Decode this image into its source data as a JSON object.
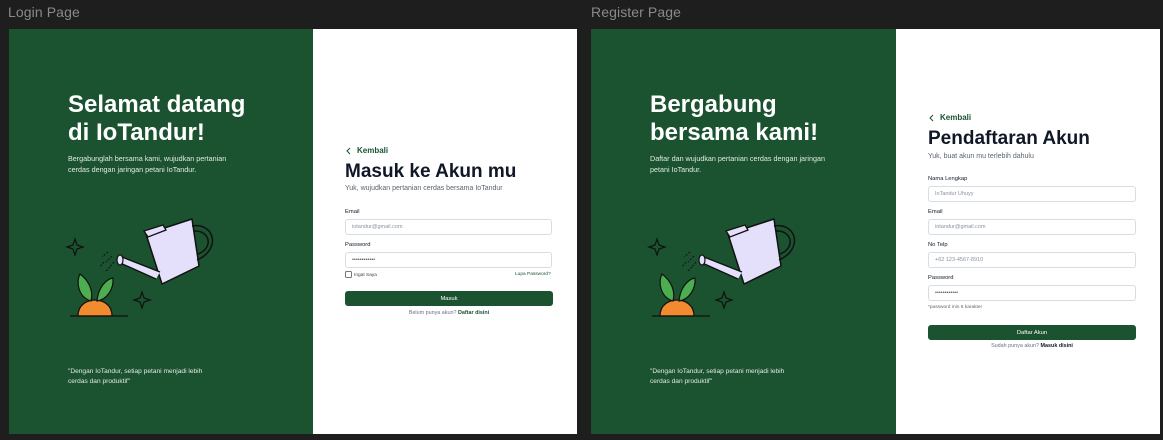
{
  "canvas": {
    "login_label": "Login Page",
    "register_label": "Register Page"
  },
  "login": {
    "hero_title_line1": "Selamat datang",
    "hero_title_line2": "di IoTandur!",
    "hero_subtitle": "Bergabunglah bersama kami, wujudkan pertanian cerdas dengan jaringan petani IoTandur.",
    "quote": "\"Dengan IoTandur, setiap petani menjadi lebih cerdas dan produktif\"",
    "back_label": "Kembali",
    "form_title": "Masuk ke Akun mu",
    "form_subtitle": "Yuk, wujudkan pertanian cerdas bersama IoTandur",
    "email_label": "Email",
    "email_placeholder": "iotandur@gmail.com",
    "password_label": "Password",
    "password_value": "••••••••••••",
    "remember_label": "Ingat Saya",
    "forgot_label": "Lupa Password?",
    "submit_label": "Masuk",
    "no_account_text": "Belum punya akun?",
    "register_link": "Daftar disini"
  },
  "register": {
    "hero_title_line1": "Bergabung",
    "hero_title_line2": "bersama kami!",
    "hero_subtitle": "Daftar dan wujudkan pertanian cerdas dengan jaringan petani IoTandur.",
    "quote": "\"Dengan IoTandur, setiap petani menjadi lebih cerdas dan produktif\"",
    "back_label": "Kembali",
    "form_title": "Pendaftaran Akun",
    "form_subtitle": "Yuk, buat akun mu terlebih dahulu",
    "name_label": "Nama Lengkap",
    "name_placeholder": "IoTandur Uhuyy",
    "email_label": "Email",
    "email_placeholder": "iotandur@gmail.com",
    "phone_label": "No Telp",
    "phone_placeholder": "+62 123-4567-8910",
    "password_label": "Password",
    "password_value": "••••••••••••",
    "password_hint": "*password min 8 karakter",
    "submit_label": "Daftar Akun",
    "have_account_text": "Sudah punya akun?",
    "login_link": "Masuk disini"
  },
  "colors": {
    "brand_green": "#1b5230",
    "canvas_bg": "#1e1e1e",
    "illustration_lavender": "#e4e0fb",
    "leaf_green": "#4cae4f",
    "soil_orange": "#f28b30"
  },
  "icons": [
    "chevron-left-icon",
    "watering-can-icon",
    "sparkle-icon",
    "sprout-icon"
  ]
}
